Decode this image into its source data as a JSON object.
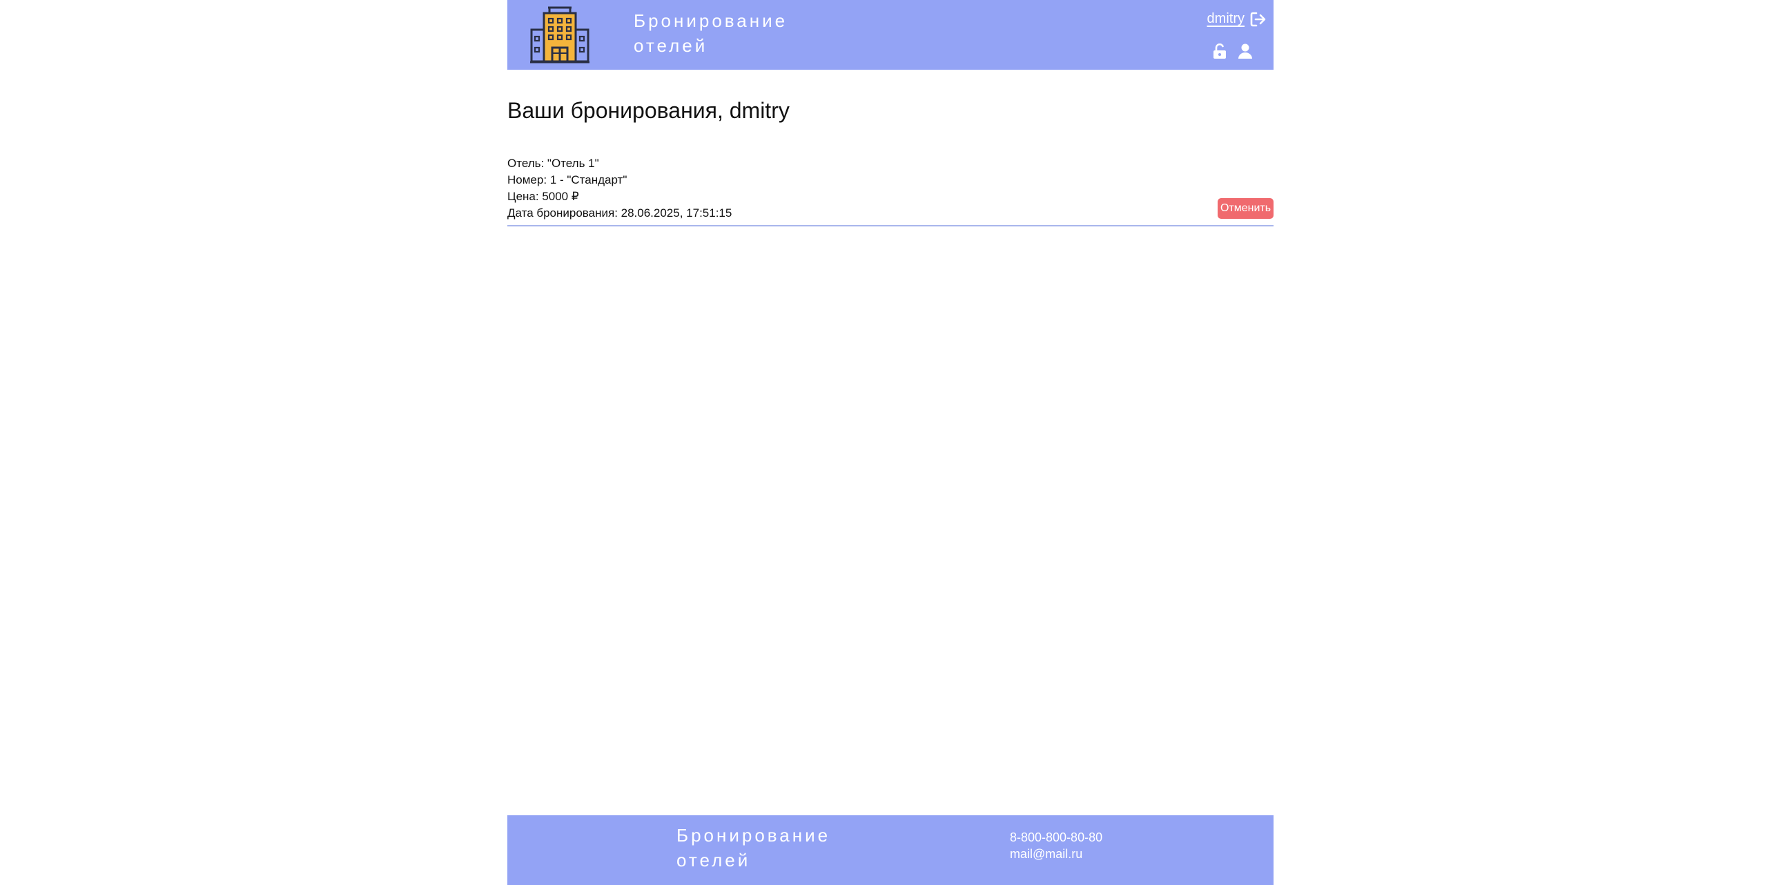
{
  "header": {
    "brand_line1": "Бронирование",
    "brand_line2": "отелей",
    "username": "dmitry",
    "logo_icon": "hotel-building-icon",
    "logout_icon": "logout-icon",
    "lock_icon": "unlock-icon",
    "profile_icon": "user-icon"
  },
  "main": {
    "title": "Ваши бронирования, dmitry",
    "bookings": [
      {
        "hotel": "Отель: \"Отель 1\"",
        "room": "Номер: 1 - \"Стандарт\"",
        "price": "Цена: 5000 ₽",
        "date": "Дата бронирования: 28.06.2025, 17:51:15",
        "cancel_label": "Отменить"
      }
    ]
  },
  "footer": {
    "brand_line1": "Бронирование",
    "brand_line2": "отелей",
    "phone": "8-800-800-80-80",
    "email": "mail@mail.ru"
  },
  "colors": {
    "accent": "#93a3f5",
    "cancel": "#f06a6e",
    "logo_body": "#f4b43c",
    "logo_outline": "#2a2f45"
  }
}
